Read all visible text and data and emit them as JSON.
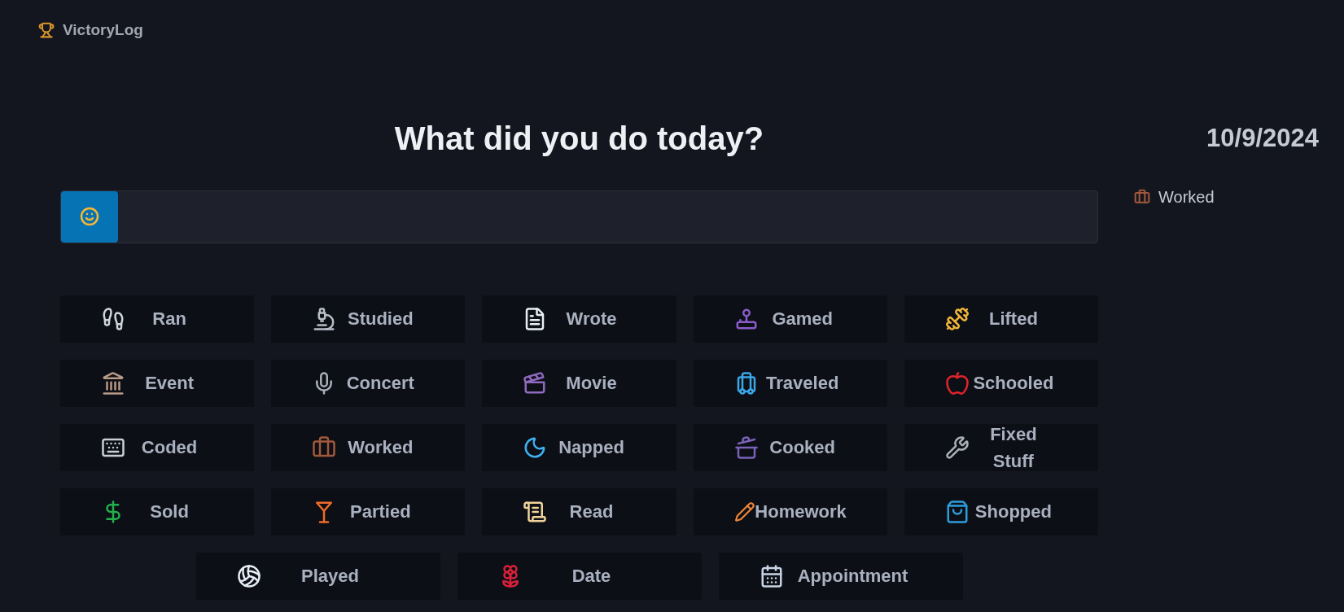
{
  "app": {
    "name": "VictoryLog"
  },
  "heading": "What did you do today?",
  "entry": {
    "mood_button": {
      "selected": true
    }
  },
  "activities": [
    {
      "label": "Ran"
    },
    {
      "label": "Studied"
    },
    {
      "label": "Wrote"
    },
    {
      "label": "Gamed"
    },
    {
      "label": "Lifted"
    },
    {
      "label": "Event"
    },
    {
      "label": "Concert"
    },
    {
      "label": "Movie"
    },
    {
      "label": "Traveled"
    },
    {
      "label": "Schooled"
    },
    {
      "label": "Coded"
    },
    {
      "label": "Worked"
    },
    {
      "label": "Napped"
    },
    {
      "label": "Cooked"
    },
    {
      "label": "Fixed Stuff"
    },
    {
      "label": "Sold"
    },
    {
      "label": "Partied"
    },
    {
      "label": "Read"
    },
    {
      "label": "Homework"
    },
    {
      "label": "Shopped"
    }
  ],
  "extra_activities": [
    {
      "label": "Played"
    },
    {
      "label": "Date"
    },
    {
      "label": "Appointment"
    }
  ],
  "sidebar": {
    "date": "10/9/2024",
    "log": [
      {
        "label": "Worked"
      }
    ]
  }
}
